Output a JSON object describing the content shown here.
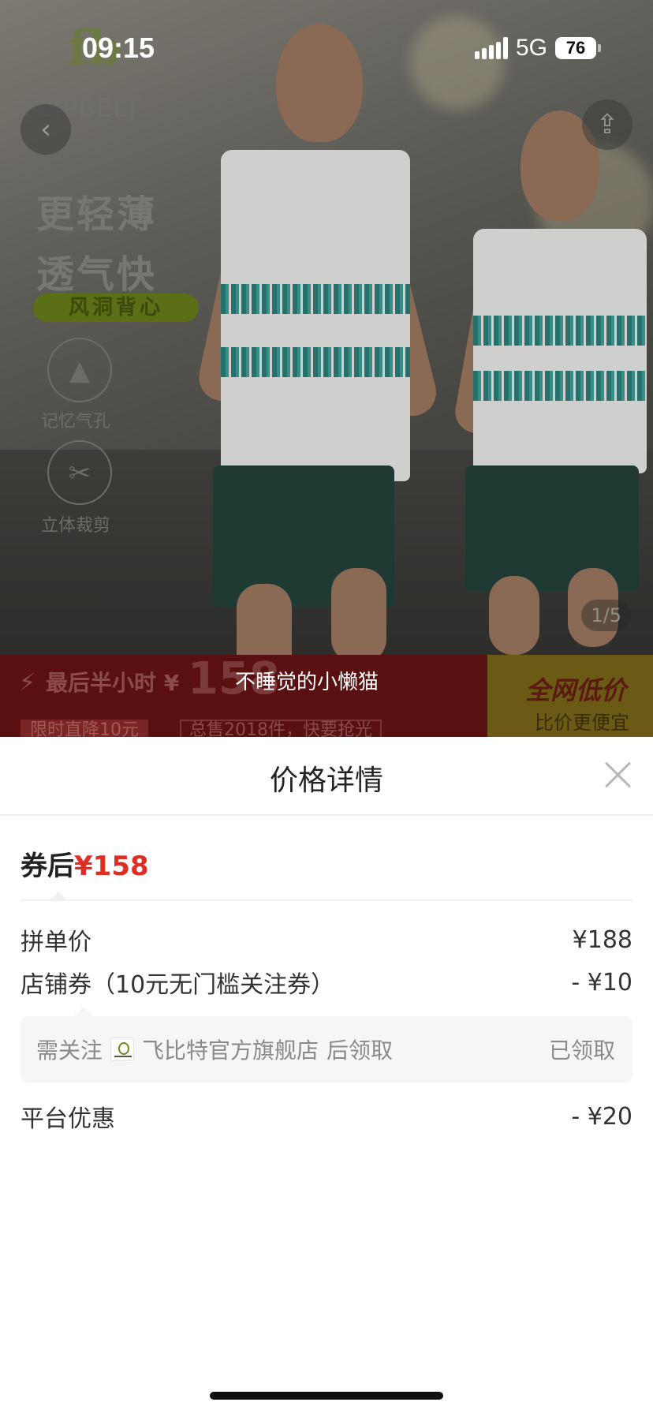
{
  "status_bar": {
    "time": "09:15",
    "network": "5G",
    "battery": "76"
  },
  "product_image": {
    "brand_word": "FLIPBELT",
    "headline_1": "更轻薄",
    "headline_2": "透气快",
    "pill": "风洞背心",
    "feature_1": "记忆气孔",
    "feature_2": "立体裁剪",
    "page_indicator": "1/5"
  },
  "promo_strip": {
    "left_text": "最后半小时 ¥",
    "big_price": "158",
    "tag_1": "限时直降10元",
    "tag_2": "总售2018件，快要抢光",
    "right_title": "全网低价",
    "right_sub": "比价更便宜"
  },
  "toast": "不睡觉的小懒猫",
  "sheet": {
    "title": "价格详情",
    "final_label": "券后",
    "final_price": "¥158",
    "rows": [
      {
        "label": "拼单价",
        "value": "¥188"
      },
      {
        "label": "店铺券（10元无门槛关注券）",
        "value": "- ¥10"
      },
      {
        "label": "平台优惠",
        "value": "- ¥20"
      }
    ],
    "coupon": {
      "prefix": "需关注",
      "shop_name": "飞比特官方旗舰店",
      "suffix": "后领取",
      "status": "已领取"
    }
  },
  "colors": {
    "price_red": "#e02e24",
    "text_dark": "#222222",
    "text_gray": "#8a8a8a"
  }
}
